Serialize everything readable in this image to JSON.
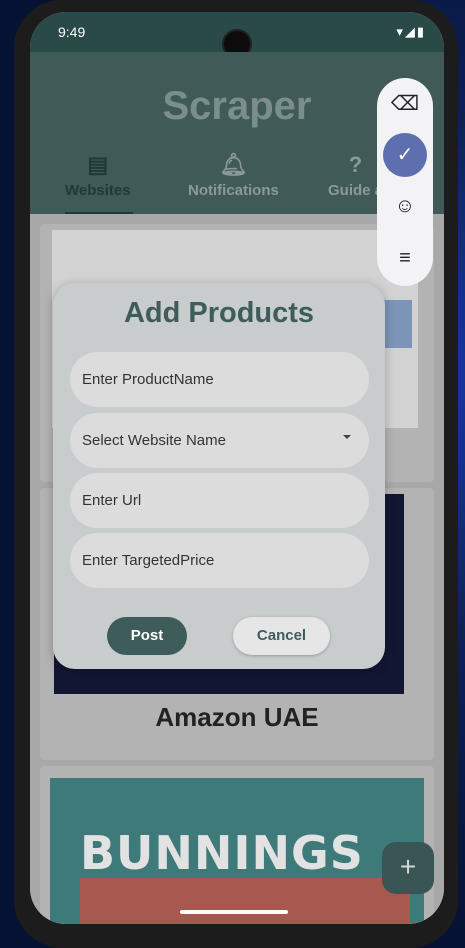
{
  "status_bar": {
    "time": "9:49",
    "icons": "▾◢▮"
  },
  "app": {
    "title": "Scraper",
    "tabs": [
      {
        "label": "Websites",
        "icon": "browser-window-icon"
      },
      {
        "label": "Notifications",
        "icon": "bell-icon"
      },
      {
        "label": "Guide a",
        "icon": "help-icon"
      }
    ]
  },
  "cards": {
    "amazon_title": "Amazon UAE",
    "bunnings_text": "BUNNINGS"
  },
  "fab": {
    "label": "+"
  },
  "dialog": {
    "title": "Add Products",
    "fields": {
      "product_name": {
        "placeholder": "Enter ProductName"
      },
      "website": {
        "placeholder": "Select Website Name"
      },
      "url": {
        "placeholder": "Enter Url"
      },
      "target_price": {
        "placeholder": "Enter TargetedPrice"
      }
    },
    "post_label": "Post",
    "cancel_label": "Cancel"
  },
  "keyboard_tools": {
    "backspace": "⌫",
    "check": "✓",
    "emoji": "☺",
    "menu": "≡"
  },
  "colors": {
    "accent": "#3e5c5a",
    "keyboard_check": "#5d6fae"
  }
}
